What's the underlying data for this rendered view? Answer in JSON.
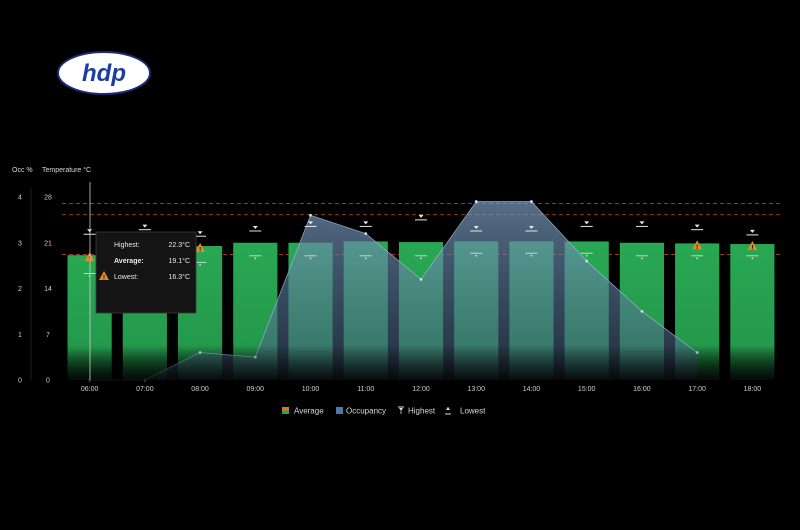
{
  "chart_data": {
    "type": "bar",
    "title": "",
    "xlabel": "",
    "ylabel_left": "Occ %",
    "ylabel_right": "Temperature °C",
    "categories": [
      "06:00",
      "07:00",
      "08:00",
      "09:00",
      "10:00",
      "11:00",
      "12:00",
      "13:00",
      "14:00",
      "15:00",
      "16:00",
      "17:00",
      "18:00"
    ],
    "occ_ticks": [
      "0",
      "1",
      "2",
      "3",
      "4"
    ],
    "temp_ticks": [
      "0",
      "7",
      "14",
      "21",
      "28"
    ],
    "temp_range": [
      0,
      28
    ],
    "series": [
      {
        "name": "Average",
        "kind": "bar",
        "values": [
          19.1,
          20.0,
          20.5,
          21.0,
          21.0,
          21.2,
          21.1,
          21.2,
          21.2,
          21.2,
          21.0,
          20.9,
          20.8
        ]
      },
      {
        "name": "Occupancy",
        "kind": "area",
        "values": [
          0,
          0,
          0.6,
          0.5,
          3.6,
          3.2,
          2.2,
          3.9,
          3.9,
          2.6,
          1.5,
          0.6,
          null
        ]
      },
      {
        "name": "Highest",
        "kind": "marker",
        "values": [
          22.3,
          23.0,
          22.0,
          22.8,
          23.5,
          23.5,
          24.5,
          22.8,
          22.8,
          23.5,
          23.5,
          23.0,
          22.2
        ]
      },
      {
        "name": "Lowest",
        "kind": "marker",
        "values": [
          16.3,
          18.4,
          18.0,
          19.0,
          19.0,
          19.0,
          19.0,
          19.4,
          19.4,
          19.4,
          19.0,
          19.0,
          19.0
        ]
      }
    ],
    "threshold_lines_temp": [
      27.0,
      25.3,
      19.2
    ],
    "warning_hours": [
      "06:00",
      "08:00",
      "17:00",
      "18:00"
    ],
    "legend": [
      "Average",
      "Occupancy",
      "Highest",
      "Lowest"
    ],
    "legend_position": "bottom",
    "tooltip": {
      "hour": "06:00",
      "rows": [
        {
          "label": "Highest:",
          "value": "22.3°C"
        },
        {
          "label": "Average:",
          "value": "19.1°C"
        },
        {
          "label": "Lowest:",
          "value": "16.3°C"
        }
      ]
    },
    "colors": {
      "bar": "#27a452",
      "area": "#6a8fb4",
      "threshold": "#b0432a",
      "warning": "#e08a2a"
    }
  },
  "logo": {
    "text": "hdp"
  }
}
